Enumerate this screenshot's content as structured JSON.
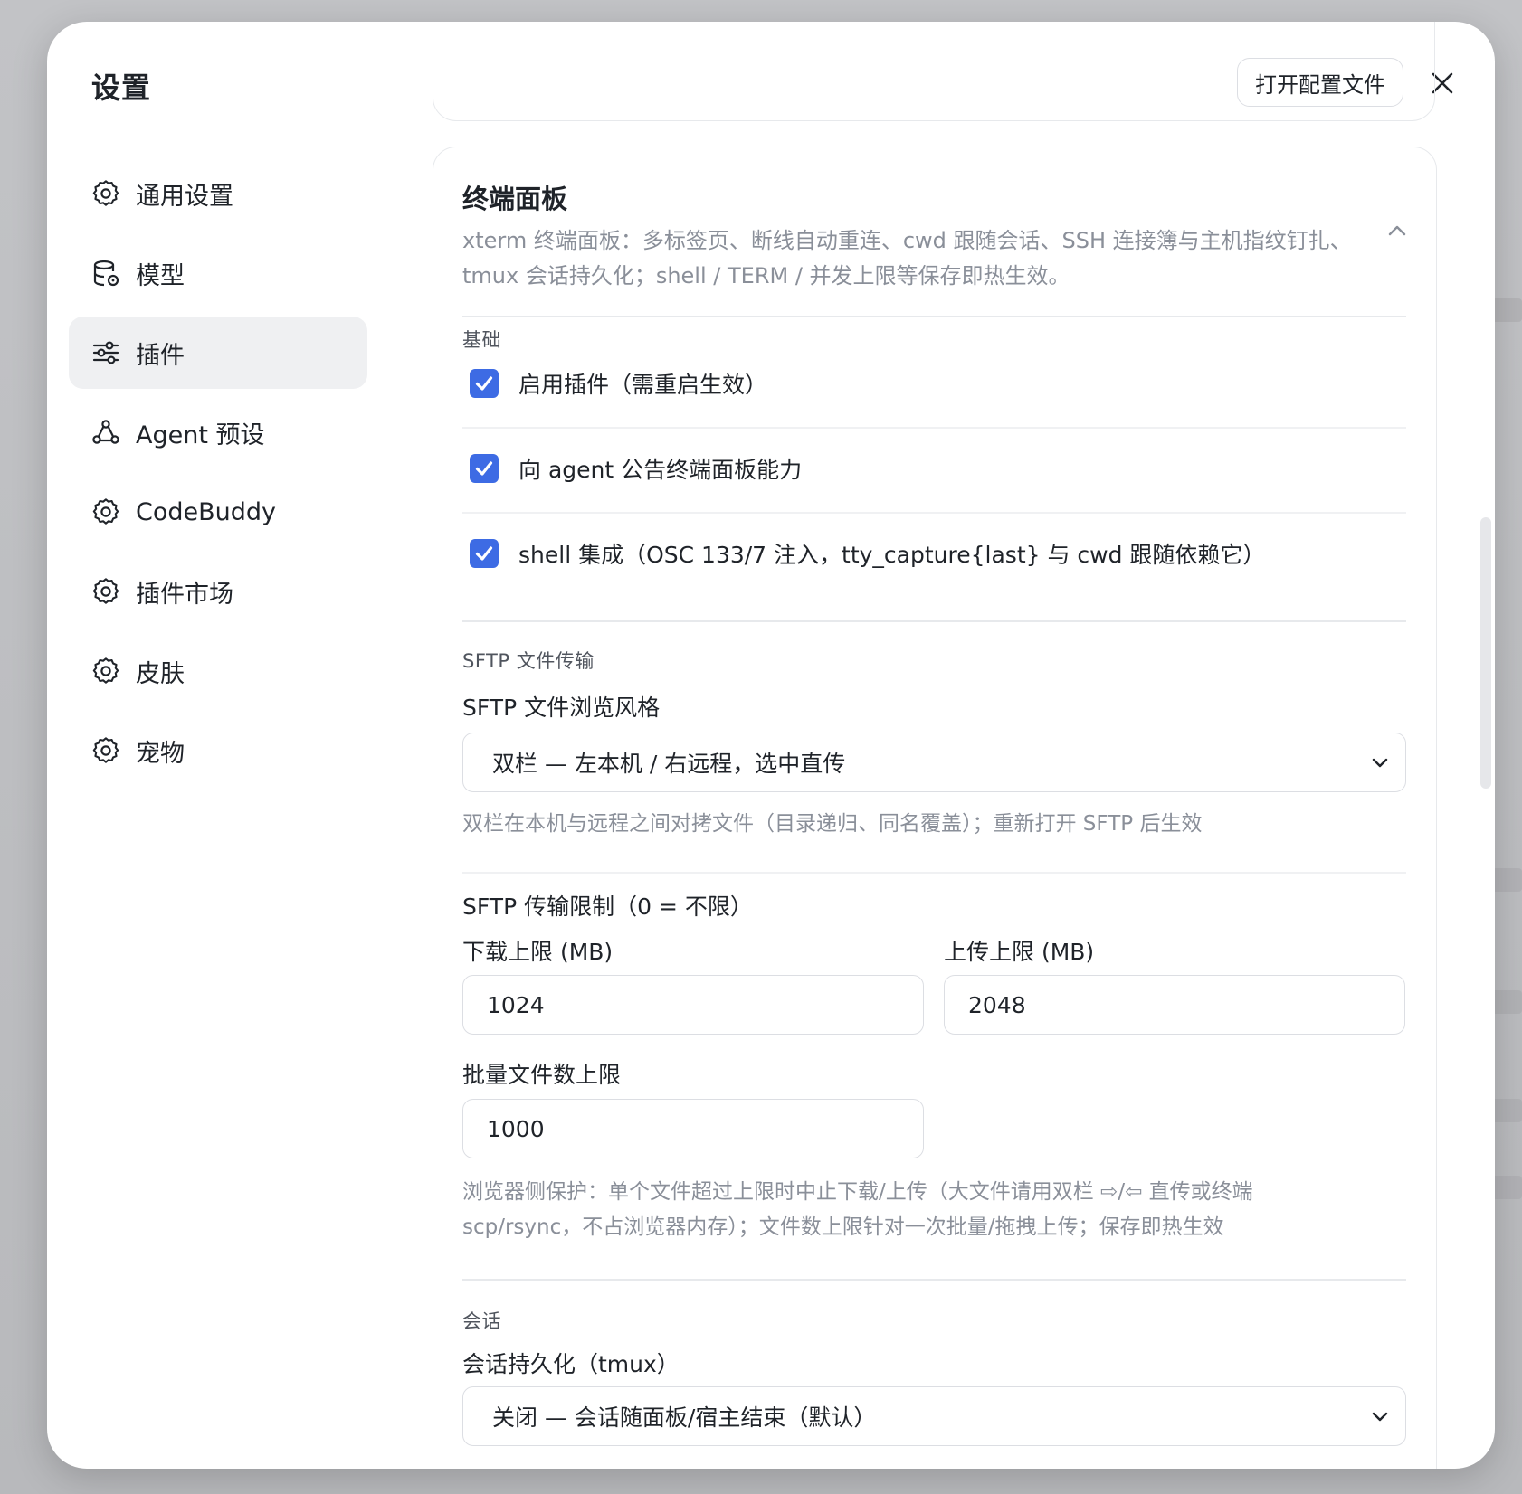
{
  "modal": {
    "title": "设置",
    "open_config_label": "打开配置文件"
  },
  "sidebar": {
    "items": [
      {
        "label": "通用设置",
        "icon": "gear-icon",
        "active": false
      },
      {
        "label": "模型",
        "icon": "database-icon",
        "active": false
      },
      {
        "label": "插件",
        "icon": "sliders-icon",
        "active": true
      },
      {
        "label": "Agent 预设",
        "icon": "agent-icon",
        "active": false
      },
      {
        "label": "CodeBuddy",
        "icon": "gear-icon",
        "active": false
      },
      {
        "label": "插件市场",
        "icon": "gear-icon",
        "active": false
      },
      {
        "label": "皮肤",
        "icon": "gear-icon",
        "active": false
      },
      {
        "label": "宠物",
        "icon": "gear-icon",
        "active": false
      }
    ]
  },
  "panel": {
    "title": "终端面板",
    "description": "xterm 终端面板：多标签页、断线自动重连、cwd 跟随会话、SSH 连接簿与主机指纹钉扎、tmux 会话持久化；shell / TERM / 并发上限等保存即热生效。",
    "basic": {
      "label": "基础",
      "checks": [
        {
          "label": "启用插件（需重启生效）",
          "checked": true
        },
        {
          "label": "向 agent 公告终端面板能力",
          "checked": true
        },
        {
          "label": "shell 集成（OSC 133/7 注入，tty_capture{last} 与 cwd 跟随依赖它）",
          "checked": true
        }
      ]
    },
    "sftp": {
      "label": "SFTP 文件传输",
      "style_label": "SFTP 文件浏览风格",
      "style_value": "双栏 — 左本机 / 右远程，选中直传",
      "style_hint": "双栏在本机与远程之间对拷文件（目录递归、同名覆盖）；重新打开 SFTP 后生效",
      "limit_title": "SFTP 传输限制（0 = 不限）",
      "download_label": "下载上限 (MB)",
      "download_value": "1024",
      "upload_label": "上传上限 (MB)",
      "upload_value": "2048",
      "batch_label": "批量文件数上限",
      "batch_value": "1000",
      "limit_hint_1": "浏览器侧保护：单个文件超过上限时中止下载/上传（大文件请用双栏 ⇨/⇦ 直传或终端",
      "limit_hint_2": "scp/rsync，不占浏览器内存）；文件数上限针对一次批量/拖拽上传；保存即热生效"
    },
    "session": {
      "label": "会话",
      "persist_label": "会话持久化（tmux）",
      "persist_value": "关闭 — 会话随面板/宿主结束（默认）"
    }
  },
  "colors": {
    "accent": "#3d6be4",
    "active_nav_bg": "#eff0f2",
    "muted_text": "#8a8f99"
  }
}
